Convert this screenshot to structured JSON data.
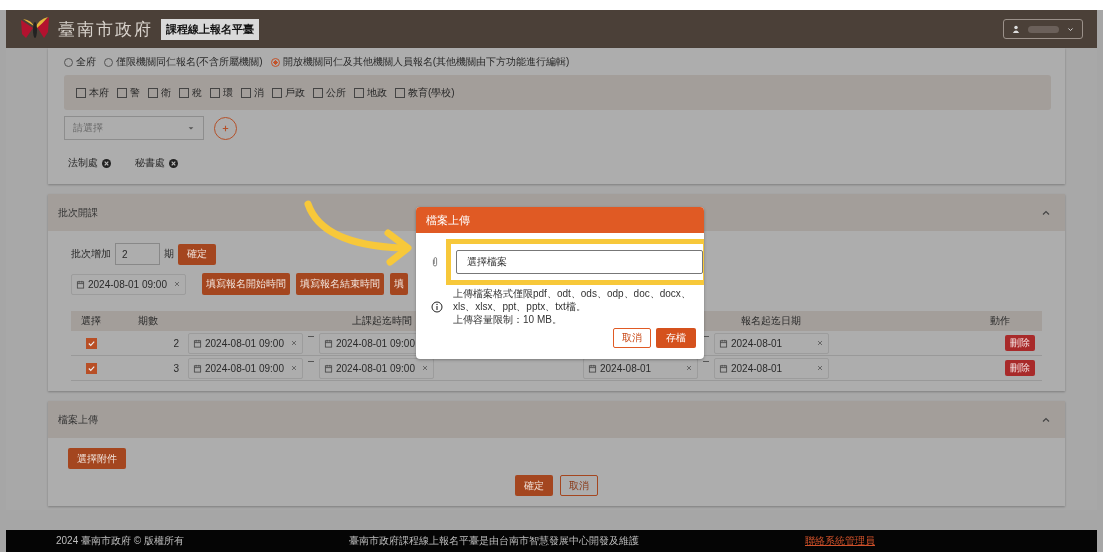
{
  "header": {
    "org_name": "臺南市政府",
    "app_title": "課程線上報名平臺"
  },
  "scope": {
    "radios": [
      {
        "label": "全府",
        "selected": false
      },
      {
        "label": "僅限機關同仁報名(不含所屬機關)",
        "selected": false
      },
      {
        "label": "開放機關同仁及其他機關人員報名(其他機關由下方功能進行編輯)",
        "selected": true
      }
    ],
    "units": [
      {
        "label": "本府",
        "checked": false
      },
      {
        "label": "警",
        "checked": false
      },
      {
        "label": "衛",
        "checked": false
      },
      {
        "label": "稅",
        "checked": false
      },
      {
        "label": "環",
        "checked": false
      },
      {
        "label": "消",
        "checked": false
      },
      {
        "label": "戶政",
        "checked": false
      },
      {
        "label": "公所",
        "checked": false
      },
      {
        "label": "地政",
        "checked": false
      },
      {
        "label": "教育(學校)",
        "checked": false
      }
    ],
    "select": {
      "placeholder": "請選擇"
    },
    "tags": [
      "法制處",
      "秘書處"
    ]
  },
  "batch": {
    "title": "批次開課",
    "add_label": "批次增加",
    "add_value": "2",
    "add_unit": "期",
    "confirm": "確定",
    "date_value": "2024-08-01 09:00",
    "fill_buttons": [
      "填寫報名開始時間",
      "填寫報名結束時間",
      "填"
    ],
    "columns": [
      "選擇",
      "期數",
      "上課起迄時間",
      "報名起迄日期",
      "動作"
    ],
    "rows": [
      {
        "checked": true,
        "number": "2",
        "course_start": "2024-08-01 09:00",
        "course_end": "2024-08-01 09:00",
        "course_end_clear": false,
        "signup_end": "2024-08-01",
        "action": "刪除"
      },
      {
        "checked": true,
        "number": "3",
        "course_start": "2024-08-01 09:00",
        "course_end": "2024-08-01 09:00",
        "course_end_clear": true,
        "signup_start": "2024-08-01",
        "signup_end": "2024-08-01",
        "action": "刪除"
      }
    ]
  },
  "upload": {
    "title": "檔案上傳",
    "button": "選擇附件"
  },
  "actions": {
    "confirm": "確定",
    "cancel": "取消"
  },
  "footer": {
    "copyright": "2024 臺南市政府 © 版權所有",
    "credit": "臺南市政府課程線上報名平臺是由台南市智慧發展中心開發及維護",
    "link": "聯絡系統管理員"
  },
  "modal": {
    "title": "檔案上傳",
    "file_placeholder": "選擇檔案",
    "notes": [
      "上傳檔案格式僅限pdf、odt、ods、odp、doc、docx、",
      "xls、xlsx、ppt、pptx、txt檔。",
      "上傳容量限制：10 MB。"
    ],
    "cancel": "取消",
    "save": "存檔"
  }
}
